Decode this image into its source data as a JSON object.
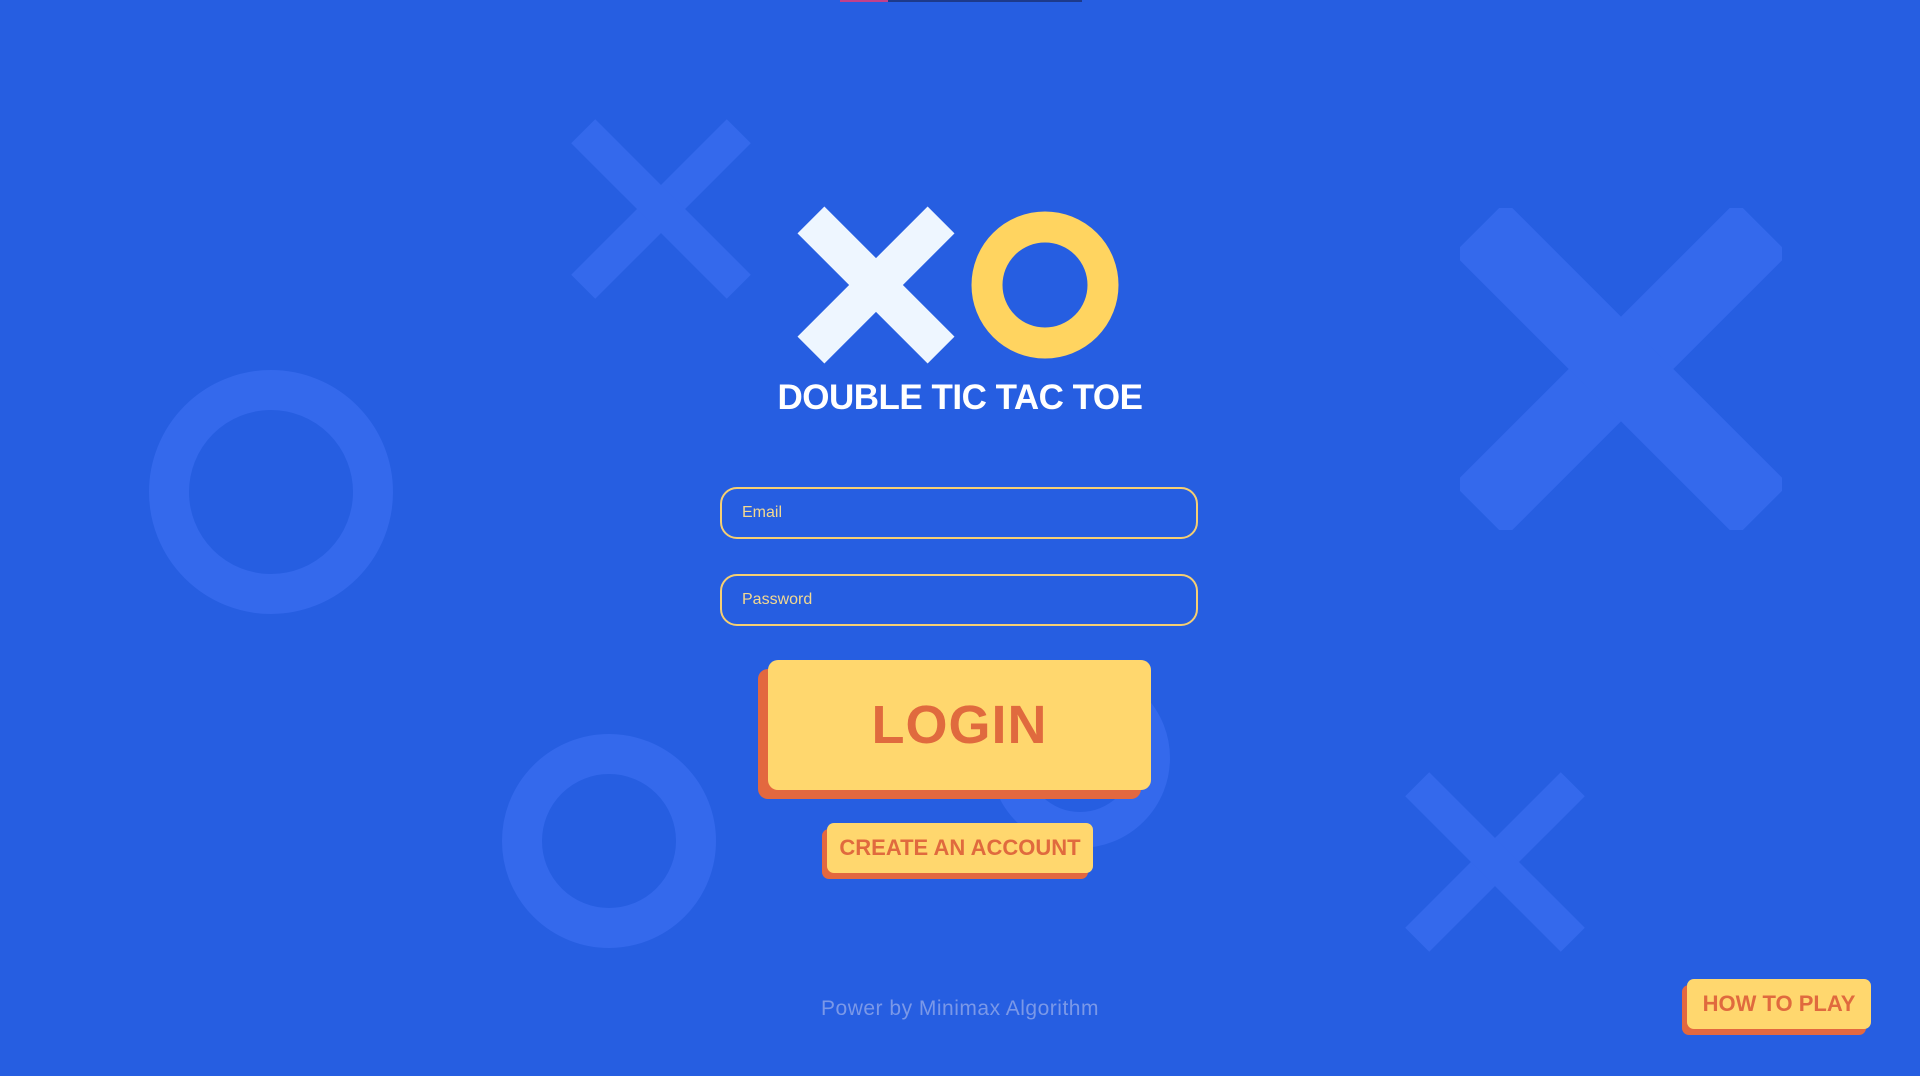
{
  "app": {
    "title": "DOUBLE TIC TAC TOE",
    "logo_icons": [
      "x-icon",
      "o-icon"
    ]
  },
  "form": {
    "email_placeholder": "Email",
    "password_placeholder": "Password",
    "login_label": "LOGIN",
    "create_account_label": "CREATE AN ACCOUNT"
  },
  "help": {
    "how_to_play_label": "HOW TO PLAY"
  },
  "footer": {
    "credit": "Power by Minimax Algorithm"
  },
  "colors": {
    "background": "#265ee1",
    "decor_shape": "#3469ec",
    "logo_x": "#eef6ff",
    "logo_o": "#ffd460",
    "button_face": "#ffd76e",
    "button_shadow": "#e3683f",
    "button_text": "#e06a3e",
    "input_border": "#f6cf72"
  }
}
